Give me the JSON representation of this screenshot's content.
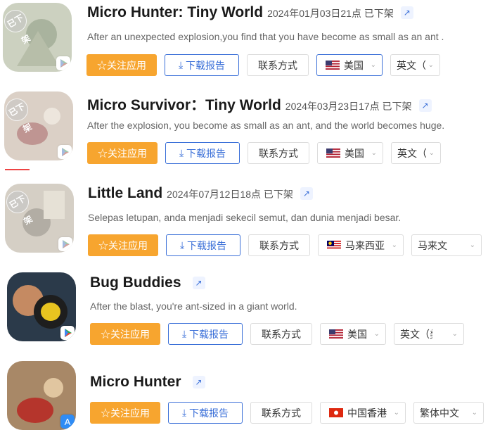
{
  "buttons": {
    "follow": "☆关注应用",
    "download": "下载报告",
    "contact": "联系方式"
  },
  "delisted_stamp": "已下架",
  "apps": [
    {
      "title": "Micro Hunter: Tiny World",
      "meta": "2024年01月03日21点 已下架",
      "desc": "After an unexpected explosion,you find that you have become as small as an ant .",
      "region": "美国",
      "language": "英文（美国）",
      "store": "google-play"
    },
    {
      "title": "Micro Survivor：Tiny World",
      "meta": "2024年03月23日17点 已下架",
      "desc": "After the explosion, you become as small as an ant, and the world becomes huge.",
      "region": "美国",
      "language": "英文（美国）",
      "store": "google-play"
    },
    {
      "title": "Little Land",
      "meta": "2024年07月12日18点 已下架",
      "desc": "Selepas letupan, anda menjadi sekecil semut, dan dunia menjadi besar.",
      "region": "马来西亚",
      "language": "马来文",
      "store": "google-play"
    },
    {
      "title": "Bug Buddies",
      "meta": "",
      "desc": "After the blast, you're ant-sized in a giant world.",
      "region": "美国",
      "language": "英文（美国）",
      "store": "google-play"
    },
    {
      "title": "Micro Hunter",
      "meta": "",
      "desc": "",
      "region": "中国香港",
      "language": "繁体中文",
      "store": "app-store"
    }
  ],
  "colors": {
    "accent_orange": "#f7a52f",
    "link_blue": "#3a6fd8"
  }
}
